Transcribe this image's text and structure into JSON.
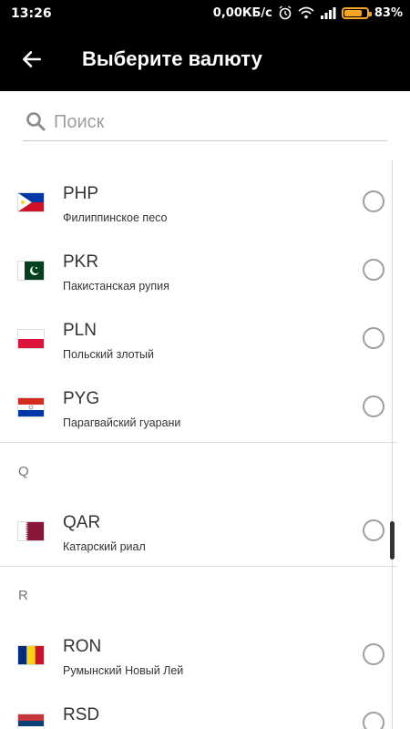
{
  "status_bar": {
    "time": "13:26",
    "net_speed": "0,00КБ/с",
    "battery_percent": "83%",
    "battery_level": 0.83
  },
  "app_bar": {
    "title": "Выберите валюту"
  },
  "search": {
    "placeholder": "Поиск"
  },
  "sections": [
    {
      "letter": ""
    },
    {
      "letter": "Q"
    },
    {
      "letter": "R"
    }
  ],
  "currencies": [
    {
      "code": "PHP",
      "name": "Филиппинское песо",
      "selected": false
    },
    {
      "code": "PKR",
      "name": "Пакистанская рупия",
      "selected": false
    },
    {
      "code": "PLN",
      "name": "Польский злотый",
      "selected": false
    },
    {
      "code": "PYG",
      "name": "Парагвайский гуарани",
      "selected": false
    },
    {
      "code": "QAR",
      "name": "Катарский риал",
      "selected": false
    },
    {
      "code": "RON",
      "name": "Румынский Новый Лей",
      "selected": false
    },
    {
      "code": "RSD",
      "name": "",
      "selected": false
    }
  ],
  "colors": {
    "bar": "#000000",
    "accent_battery": "#f5a623",
    "radio_border": "#9e9e9e"
  }
}
